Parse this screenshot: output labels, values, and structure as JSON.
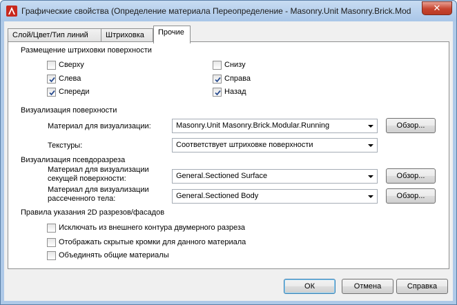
{
  "window": {
    "title": "Графические свойства (Определение материала Переопределение - Masonry.Unit Masonry.Brick.Modular.Runni...",
    "close_label": "✕"
  },
  "tabs": [
    {
      "label": "Слой/Цвет/Тип линий"
    },
    {
      "label": "Штриховка"
    },
    {
      "label": "Прочие"
    }
  ],
  "surface_hatch": {
    "title": "Размещение штриховки поверхности",
    "items": [
      {
        "label": "Сверху",
        "checked": false
      },
      {
        "label": "Слева",
        "checked": true
      },
      {
        "label": "Спереди",
        "checked": true
      },
      {
        "label": "Снизу",
        "checked": false
      },
      {
        "label": "Справа",
        "checked": true
      },
      {
        "label": "Назад",
        "checked": true
      }
    ]
  },
  "surface_render": {
    "title": "Визуализация поверхности",
    "material_label": "Материал для визуализации:",
    "material_value": "Masonry.Unit Masonry.Brick.Modular.Running",
    "browse_label": "Обзор...",
    "textures_label": "Текстуры:",
    "textures_value": "Соответствует штриховке поверхности"
  },
  "section_render": {
    "title": "Визуализация псевдоразреза",
    "cut_surface_label_1": "Материал для визуализации",
    "cut_surface_label_2": "секущей поверхности:",
    "cut_surface_value": "General.Sectioned Surface",
    "browse1_label": "Обзор...",
    "body_label_1": "Материал для визуализации",
    "body_label_2": "рассеченного тела:",
    "body_value": "General.Sectioned Body",
    "browse2_label": "Обзор..."
  },
  "rules": {
    "title": "Правила указания 2D разрезов/фасадов",
    "items": [
      {
        "label": "Исключать из внешнего контура двумерного разреза",
        "checked": false
      },
      {
        "label": "Отображать скрытые кромки для данного материала",
        "checked": false
      },
      {
        "label": "Объединять общие материалы",
        "checked": false
      }
    ]
  },
  "footer": {
    "ok_label": "ОК",
    "cancel_label": "Отмена",
    "help_label": "Справка"
  },
  "colors": {
    "titlebar": "#b9d1ee",
    "close": "#c7442f",
    "panel": "#ffffff",
    "dialog": "#f0f0f0"
  }
}
